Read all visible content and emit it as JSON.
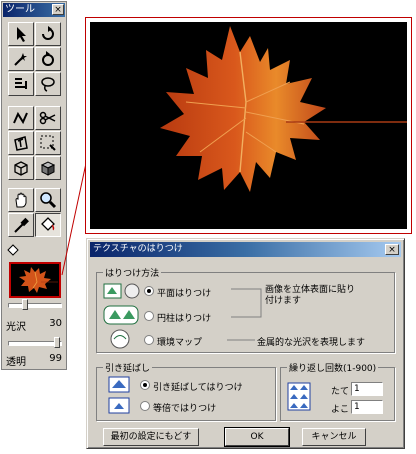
{
  "palette": {
    "title": "ツール",
    "close": "×",
    "gloss_label": "光沢",
    "gloss_value": "30",
    "opacity_label": "透明",
    "opacity_value": "99",
    "tools": [
      "arrow",
      "lasso-rotate",
      "magic-wand",
      "rotate-3d",
      "select-rect",
      "lasso",
      "pen",
      "scissors",
      "text-3d",
      "rect-select-dots",
      "cube-outline",
      "cube-solid",
      "hand",
      "zoom",
      "eyedropper",
      "paint-bucket"
    ]
  },
  "dialog": {
    "title": "テクスチャのはりつけ",
    "close": "×",
    "paste_group_label": "はりつけ方法",
    "paste_options": [
      "平面はりつけ",
      "円柱はりつけ",
      "環境マップ"
    ],
    "paste_selected": "平面はりつけ",
    "desc_flat": "画像を立体表面に貼り付けます",
    "desc_env": "金属的な光沢を表現します",
    "stretch_group_label": "引き延ばし",
    "stretch_options": [
      "引き延ばしてはりつけ",
      "等倍ではりつけ"
    ],
    "stretch_selected": "引き延ばしてはりつけ",
    "repeat_group_label": "繰り返し回数(1-900)",
    "repeat_v_label": "たて",
    "repeat_v_value": "1",
    "repeat_h_label": "よこ",
    "repeat_h_value": "1",
    "reset_button": "最初の設定にもどす",
    "ok_button": "OK",
    "cancel_button": "キャンセル"
  },
  "colors": {
    "title_start": "#0a246a",
    "title_end": "#a6caf0",
    "highlight": "#c00000",
    "face": "#d4d0c8"
  }
}
